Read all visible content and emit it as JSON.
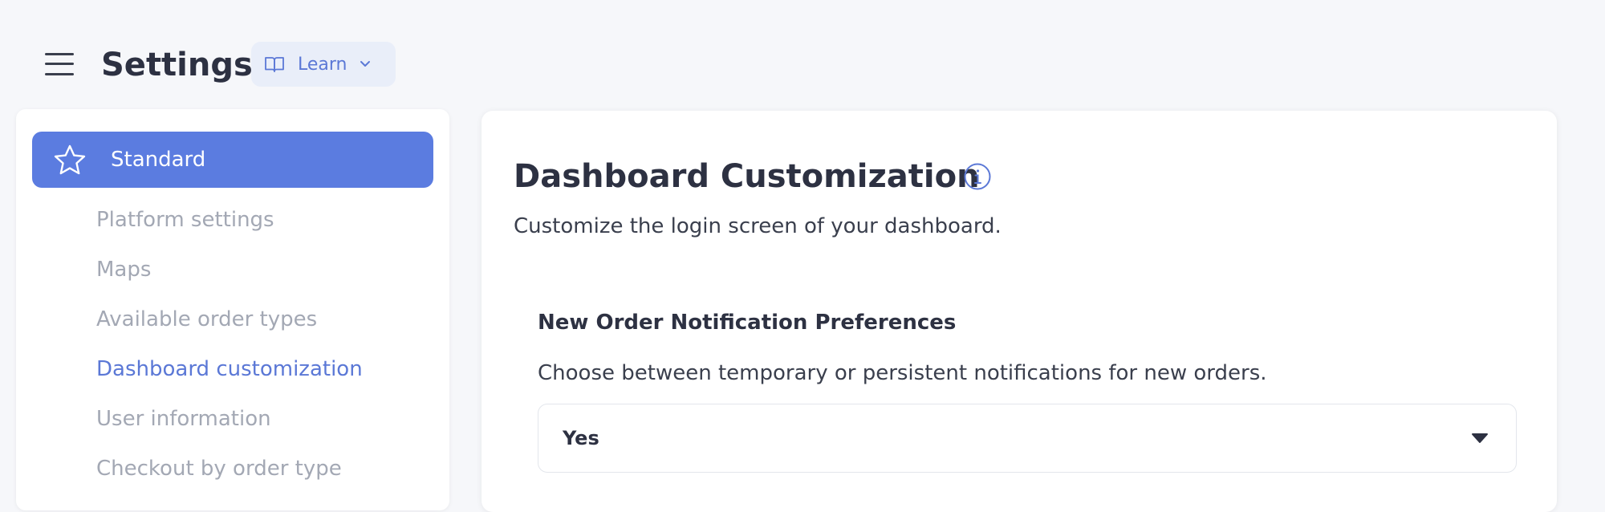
{
  "header": {
    "title": "Settings",
    "learn_label": "Learn",
    "icons": {
      "menu": "hamburger-menu-icon",
      "learn": "book-open-icon",
      "dropdown": "chevron-down-icon"
    }
  },
  "sidebar": {
    "section": {
      "label": "Standard",
      "icon": "star-icon"
    },
    "items": [
      {
        "label": "Platform settings"
      },
      {
        "label": "Maps"
      },
      {
        "label": "Available order types"
      },
      {
        "label": "Dashboard customization"
      },
      {
        "label": "User information"
      },
      {
        "label": "Checkout by order type"
      }
    ],
    "active_item": "Dashboard customization"
  },
  "main": {
    "title": "Dashboard Customization",
    "title_icon": "info-icon",
    "description": "Customize the login screen of your dashboard.",
    "notification": {
      "title": "New Order Notification Preferences",
      "description": "Choose between temporary or persistent notifications for new orders.",
      "select_value": "Yes"
    }
  },
  "colors": {
    "accent": "#5b7ce0",
    "accent_text": "#5b78d6",
    "learn_bg": "#e9eef9",
    "muted_text": "#a3a8b4"
  }
}
